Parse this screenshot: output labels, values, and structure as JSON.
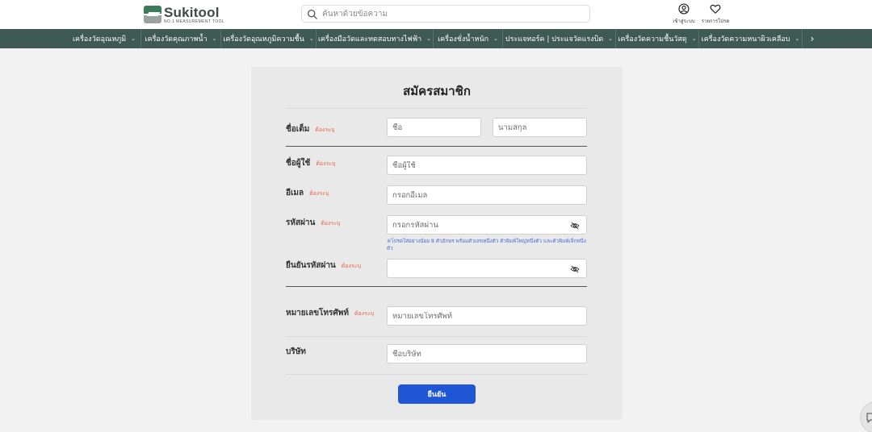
{
  "header": {
    "logo": {
      "name": "Sukitool",
      "tagline": "NO.1 MEASUREMENT TOOL"
    },
    "search": {
      "placeholder": "ค้นหาด้วยข้อความ"
    },
    "login_label": "เข้าสู่ระบบ",
    "wishlist_label": "รายการโปรด"
  },
  "nav": {
    "items": [
      {
        "label": "เครื่องวัดอุณหภูมิ"
      },
      {
        "label": "เครื่องวัดคุณภาพน้ำ"
      },
      {
        "label": "เครื่องวัดอุณหภูมิความชื้น"
      },
      {
        "label": "เครื่องมือวัดและทดสอบทางไฟฟ้า"
      },
      {
        "label": "เครื่องชั่งน้ำหนัก"
      },
      {
        "label": "ประแจทอร์ค | ประแจวัดแรงบิด"
      },
      {
        "label": "เครื่องวัดความชื้นวัสดุ"
      },
      {
        "label": "เครื่องวัดความหนาผิวเคลือบ"
      }
    ]
  },
  "form": {
    "title": "สมัครสมาชิก",
    "required_text": "ต้องระบุ",
    "fullname": {
      "label": "ชื่อเต็ม",
      "first_placeholder": "ชื่อ",
      "last_placeholder": "นามสกุล"
    },
    "username": {
      "label": "ชื่อผู้ใช้",
      "placeholder": "ชื่อผู้ใช้"
    },
    "email": {
      "label": "อีเมล",
      "placeholder": "กรอกอีเมล"
    },
    "password": {
      "label": "รหัสผ่าน",
      "placeholder": "กรอกรหัสผ่าน",
      "hint": "※โปรดใส่อย่างน้อย 8 ตัวอักษร พร้อมตัวเลขหนึ่งตัว ตัวพิมพ์ใหญ่หนึ่งตัว และตัวพิมพ์เล็กหนึ่งตัว"
    },
    "confirm_password": {
      "label": "ยืนยันรหัสผ่าน",
      "placeholder": ""
    },
    "phone": {
      "label": "หมายเลขโทรศัพท์",
      "placeholder": "หมายเลขโทรศัพท์"
    },
    "company": {
      "label": "บริษัท",
      "placeholder": "ชื่อบริษัท"
    },
    "submit_label": "ยืนยัน"
  },
  "icons": {
    "search": "search-icon",
    "login": "user-circle-icon",
    "wishlist": "heart-icon",
    "eye_off": "eye-off-icon",
    "chat": "chat-icon",
    "nav_next": "chevron-right-icon"
  },
  "colors": {
    "nav_bg": "#3e5a52",
    "accent_blue": "#1f56d6",
    "required_red": "#e8624a",
    "hint_blue": "#4a6bd8"
  }
}
